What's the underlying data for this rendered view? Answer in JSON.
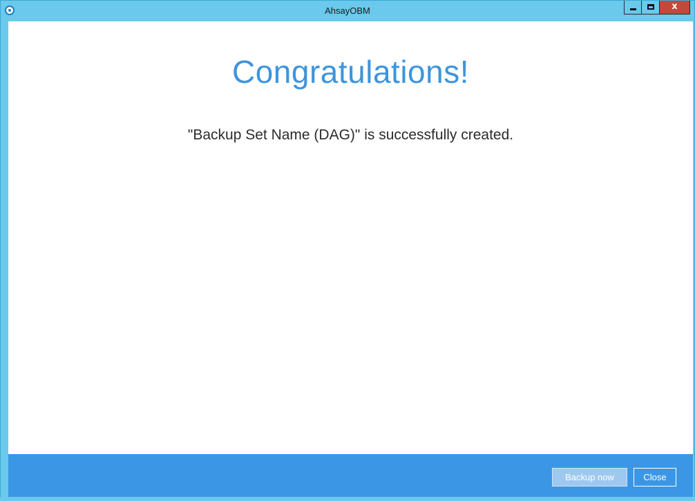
{
  "window": {
    "title": "AhsayOBM",
    "accent_color": "#6ac9ec",
    "controls": {
      "minimize_icon": "minimize-icon",
      "maximize_icon": "maximize-icon",
      "close_label": "x"
    }
  },
  "main": {
    "heading": "Congratulations!",
    "message": "\"Backup Set Name (DAG)\" is successfully created.",
    "heading_color": "#3d95dd"
  },
  "footer": {
    "background_color": "#3b97e6",
    "backup_now_label": "Backup now",
    "close_label": "Close"
  }
}
